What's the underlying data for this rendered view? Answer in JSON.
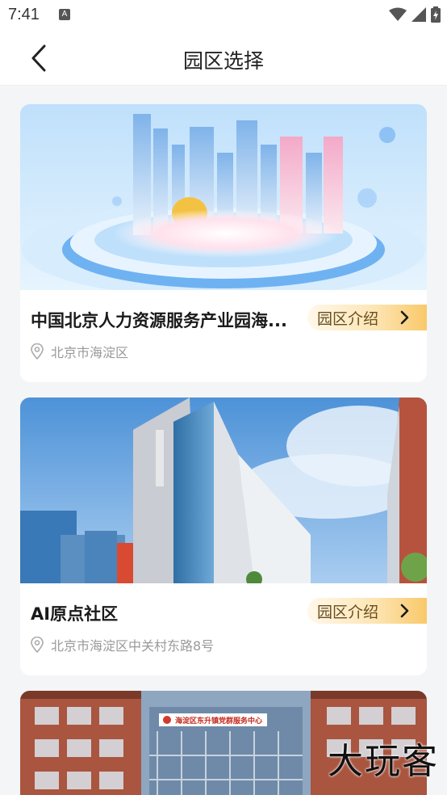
{
  "status_bar": {
    "time": "7:41",
    "notification_icon": "A"
  },
  "nav": {
    "title": "园区选择",
    "back_icon": "chevron-left-icon"
  },
  "parks": [
    {
      "name": "中国北京人力资源服务产业园海...",
      "intro_label": "园区介绍",
      "address": "北京市海淀区"
    },
    {
      "name": "AI原点社区",
      "intro_label": "园区介绍",
      "address": "北京市海淀区中关村东路8号"
    },
    {
      "sign_text": "海淀区东升镇党群服务中心"
    }
  ],
  "watermark": "大玩客",
  "colors": {
    "accent_gold": "#f9c96a",
    "intro_text": "#6b4d1d",
    "address_gray": "#9a9a9a",
    "page_bg": "#f4f5f7"
  }
}
